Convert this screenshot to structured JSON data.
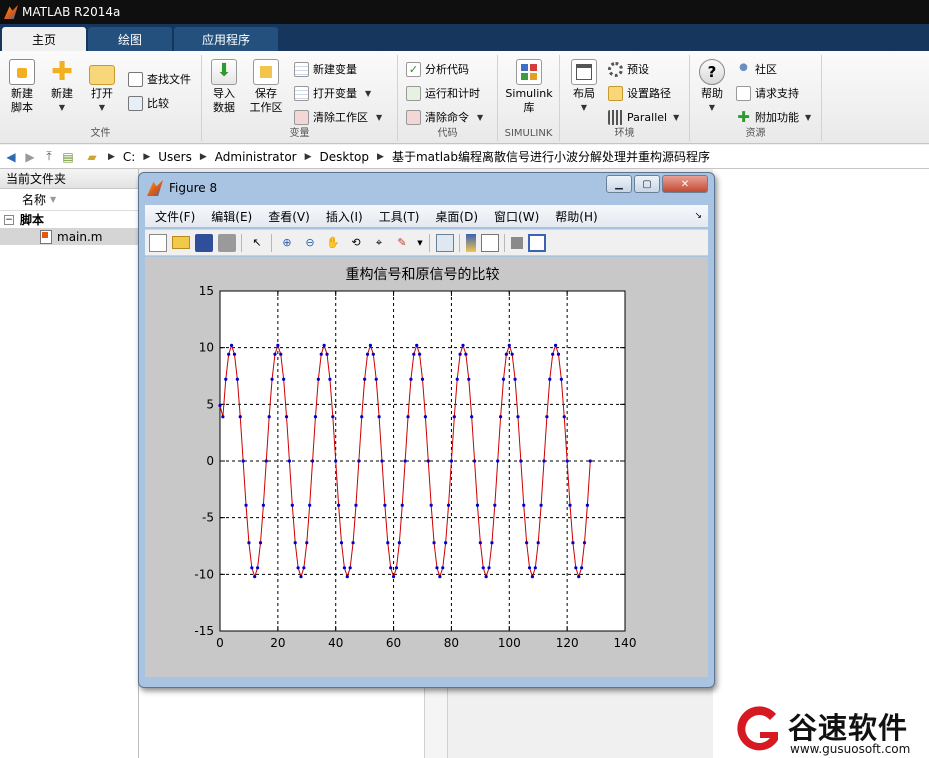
{
  "app": {
    "title": "MATLAB R2014a"
  },
  "tabs": [
    {
      "label": "主页"
    },
    {
      "label": "绘图"
    },
    {
      "label": "应用程序"
    }
  ],
  "ribbon": {
    "file": {
      "section": "文件",
      "new_script": "新建\n脚本",
      "new": "新建",
      "open": "打开",
      "find_files": "查找文件",
      "compare": "比较"
    },
    "variable": {
      "section": "变量",
      "import_data": "导入\n数据",
      "save_workspace": "保存\n工作区",
      "new_variable": "新建变量",
      "open_variable": "打开变量",
      "clear_workspace": "清除工作区"
    },
    "code": {
      "section": "代码",
      "analyze_code": "分析代码",
      "run_and_time": "运行和计时",
      "clear_commands": "清除命令"
    },
    "simulink": {
      "section": "SIMULINK",
      "simulink_lib": "Simulink\n库"
    },
    "environment": {
      "section": "环境",
      "layout": "布局",
      "preferences": "预设",
      "set_path": "设置路径",
      "parallel": "Parallel"
    },
    "resources": {
      "section": "资源",
      "help": "帮助",
      "community": "社区",
      "request_support": "请求支持",
      "add_ons": "附加功能"
    }
  },
  "address": {
    "parts": [
      "C:",
      "Users",
      "Administrator",
      "Desktop",
      "基于matlab编程离散信号进行小波分解处理并重构源码程序"
    ]
  },
  "current_folder": {
    "title": "当前文件夹",
    "col_name": "名称",
    "group": "脚本",
    "file": "main.m"
  },
  "figure": {
    "title": "Figure 8",
    "menus": [
      "文件(F)",
      "编辑(E)",
      "查看(V)",
      "插入(I)",
      "工具(T)",
      "桌面(D)",
      "窗口(W)",
      "帮助(H)"
    ]
  },
  "chart_data": {
    "type": "line",
    "title": "重构信号和原信号的比较",
    "xlabel": "",
    "ylabel": "",
    "xlim": [
      0,
      140
    ],
    "ylim": [
      -15,
      15
    ],
    "xticks": [
      0,
      20,
      40,
      60,
      80,
      100,
      120,
      140
    ],
    "yticks": [
      -15,
      -10,
      -5,
      0,
      5,
      10,
      15
    ],
    "grid": true,
    "series": [
      {
        "color": "#cc0000",
        "marker": "none",
        "amplitude": 10.2,
        "period": 16,
        "x": [
          0,
          128
        ]
      },
      {
        "color": "#0000cc",
        "marker": "point",
        "amplitude": 10.2,
        "period": 16,
        "x": [
          0,
          128
        ]
      }
    ]
  },
  "watermark": {
    "name": "谷速软件",
    "url": "www.gusuosoft.com"
  },
  "colors": {
    "tab_bg": "#16365e",
    "figure_frame": "#a9c4e2",
    "plot_bg": "#c8c8c8",
    "line_red": "#cc0000",
    "marker_blue": "#0000cc"
  }
}
